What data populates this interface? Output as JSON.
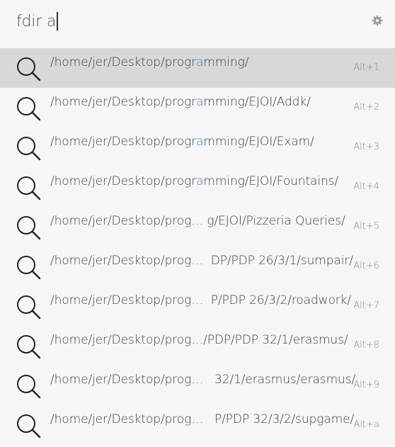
{
  "search": {
    "query": "fdir a"
  },
  "settings_icon": "gear-icon",
  "results": [
    {
      "pre": "/home/jer/Desktop/progr",
      "hl": "a",
      "post": "mming/",
      "shortcut": "Alt+1",
      "selected": true
    },
    {
      "pre": "/home/jer/Desktop/progr",
      "hl": "a",
      "post": "mming/EJOI/Addk/",
      "shortcut": "Alt+2",
      "selected": false
    },
    {
      "pre": "/home/jer/Desktop/progr",
      "hl": "a",
      "post": "mming/EJOI/Exam/",
      "shortcut": "Alt+3",
      "selected": false
    },
    {
      "pre": "/home/jer/Desktop/progr",
      "hl": "a",
      "post": "mming/EJOI/Fountains/",
      "shortcut": "Alt+4",
      "selected": false
    },
    {
      "pre": "/home/jer/Desktop/prog… g/EJOI/Pizzeria Queries/",
      "hl": "",
      "post": "",
      "shortcut": "Alt+5",
      "selected": false
    },
    {
      "pre": "/home/jer/Desktop/prog…  DP/PDP 26/3/1/sumpair/",
      "hl": "",
      "post": "",
      "shortcut": "Alt+6",
      "selected": false
    },
    {
      "pre": "/home/jer/Desktop/prog…  P/PDP 26/3/2/roadwork/",
      "hl": "",
      "post": "",
      "shortcut": "Alt+7",
      "selected": false
    },
    {
      "pre": "/home/jer/Desktop/prog…/PDP/PDP 32/1/erasmus/",
      "hl": "",
      "post": "",
      "shortcut": "Alt+8",
      "selected": false
    },
    {
      "pre": "/home/jer/Desktop/prog…   32/1/erasmus/erasmus/",
      "hl": "",
      "post": "",
      "shortcut": "Alt+9",
      "selected": false
    },
    {
      "pre": "/home/jer/Desktop/prog…   P/PDP 32/3/2/supgame/",
      "hl": "",
      "post": "",
      "shortcut": "Alt+a",
      "selected": false
    }
  ],
  "result_icon": "search-icon"
}
